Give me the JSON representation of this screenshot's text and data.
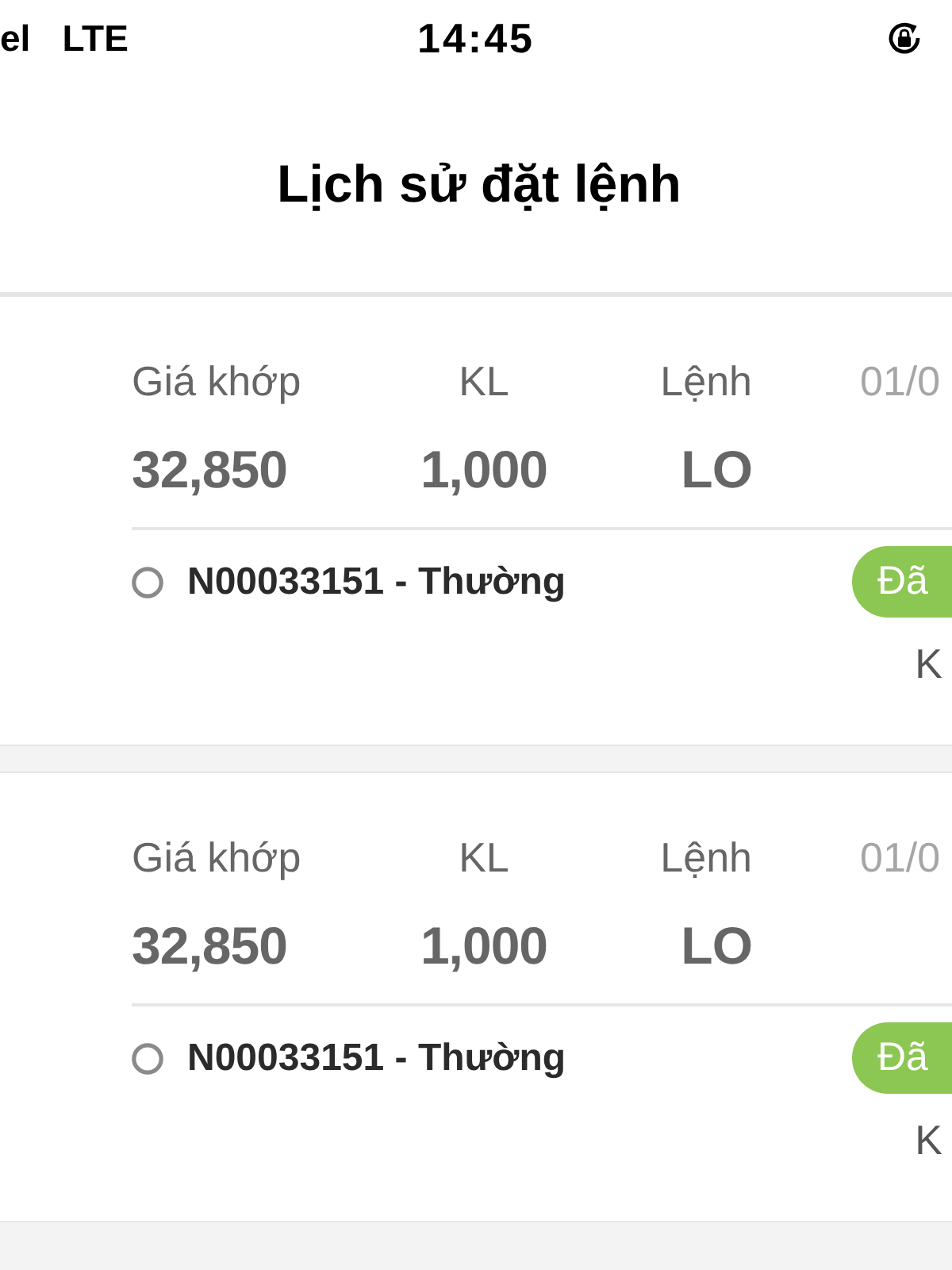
{
  "status_bar": {
    "carrier": "el",
    "network": "LTE",
    "time": "14:45"
  },
  "header": {
    "title": "Lịch sử đặt lệnh"
  },
  "orders": [
    {
      "fields": [
        {
          "label": "Giá khớp",
          "value": "32,850"
        },
        {
          "label": "KL",
          "value": "1,000"
        },
        {
          "label": "Lệnh",
          "value": "LO"
        }
      ],
      "date": "01/0",
      "order_id": "N00033151 - Thường",
      "status": "Đã",
      "note": "K"
    },
    {
      "fields": [
        {
          "label": "Giá khớp",
          "value": "32,850"
        },
        {
          "label": "KL",
          "value": "1,000"
        },
        {
          "label": "Lệnh",
          "value": "LO"
        }
      ],
      "date": "01/0",
      "order_id": "N00033151 - Thường",
      "status": "Đã",
      "note": "K"
    }
  ]
}
